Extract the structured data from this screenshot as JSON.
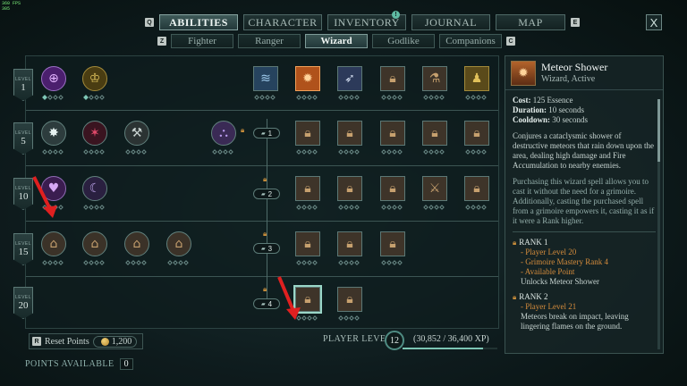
{
  "fps": {
    "line1": "360 FPS",
    "line2": "305"
  },
  "nav": {
    "key_left": "Q",
    "key_right": "E",
    "tabs": [
      "ABILITIES",
      "CHARACTER",
      "INVENTORY",
      "JOURNAL",
      "MAP"
    ],
    "journal_badge": "!",
    "close": "X"
  },
  "classes": {
    "key_left": "Z",
    "key_right": "C",
    "tabs": [
      "Fighter",
      "Ranger",
      "Wizard",
      "Godlike",
      "Companions"
    ]
  },
  "tree": {
    "levels": [
      {
        "label": "LEVEL",
        "num": "1"
      },
      {
        "label": "LEVEL",
        "num": "5"
      },
      {
        "label": "LEVEL",
        "num": "10"
      },
      {
        "label": "LEVEL",
        "num": "15"
      },
      {
        "label": "LEVEL",
        "num": "20"
      }
    ],
    "gates": [
      "1",
      "2",
      "3",
      "4"
    ]
  },
  "footer": {
    "reset_key": "R",
    "reset_label": "Reset Points",
    "reset_cost": "1,200",
    "player_level_label": "PLAYER LEVEL",
    "player_level": "12",
    "xp": "(30,852 / 36,400 XP)",
    "xp_progress": 0.848,
    "points_label": "POINTS AVAILABLE",
    "points_value": "0"
  },
  "detail": {
    "name": "Meteor Shower",
    "subtitle": "Wizard, Active",
    "cost_label": "Cost:",
    "cost_value": "125 Essence",
    "duration_label": "Duration:",
    "duration_value": "10 seconds",
    "cooldown_label": "Cooldown:",
    "cooldown_value": "30 seconds",
    "desc1": "Conjures a cataclysmic shower of destructive meteors that rain down upon the area, dealing high damage and Fire Accumulation to nearby enemies.",
    "desc2": "Purchasing this wizard spell allows you to cast it without the need for a grimoire. Additionally, casting the purchased spell from a grimoire empowers it, casting it as if it were a Rank higher.",
    "rank1_title": "RANK 1",
    "rank1_req1": "- Player Level 20",
    "rank1_req2": "- Grimoire Mastery Rank 4",
    "rank1_req3": "- Available Point",
    "rank1_unlock": "Unlocks Meteor Shower",
    "rank2_title": "RANK 2",
    "rank2_req1": "- Player Level 21",
    "rank2_desc": "Meteors break on impact, leaving lingering flames on the ground."
  },
  "colors": {
    "accent": "#7fc6b6",
    "requirement": "#d58c3c",
    "marker": "#e02020"
  }
}
